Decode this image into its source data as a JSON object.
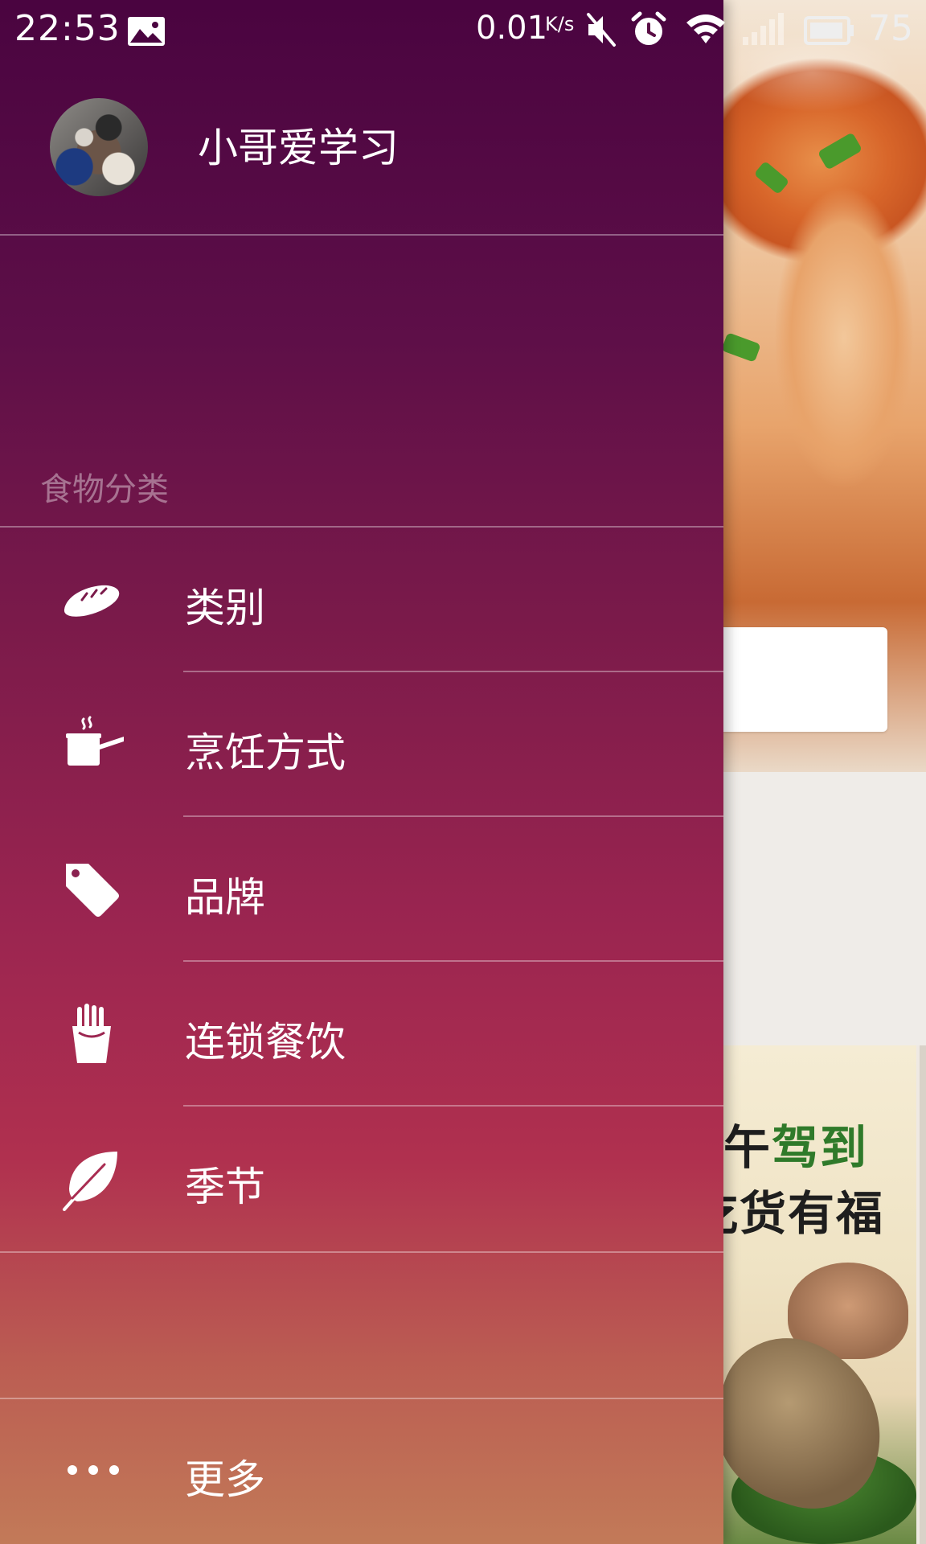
{
  "status_bar": {
    "time": "22:53",
    "network_speed": "0.01",
    "network_unit": "K/s",
    "battery_percent": "75",
    "icons": [
      "image-icon",
      "mute-icon",
      "alarm-icon",
      "wifi-icon",
      "signal-icon",
      "battery-icon"
    ]
  },
  "drawer": {
    "username": "小哥爱学习",
    "section_title": "食物分类",
    "menu_items": [
      {
        "label": "类别",
        "icon": "bread-icon"
      },
      {
        "label": "烹饪方式",
        "icon": "cooking-pot-icon"
      },
      {
        "label": "品牌",
        "icon": "tag-icon"
      },
      {
        "label": "连锁餐饮",
        "icon": "fries-icon"
      },
      {
        "label": "季节",
        "icon": "leaf-icon"
      }
    ],
    "more_label": "更多",
    "more_icon": "more-dots-icon"
  },
  "background": {
    "poster_line1_prefix": "端午",
    "poster_line1_green": "驾到",
    "poster_line2": "吃货有福"
  },
  "colors": {
    "drawer_top": "#4a0440",
    "drawer_bottom": "#c27a58",
    "text": "#ffffff"
  }
}
